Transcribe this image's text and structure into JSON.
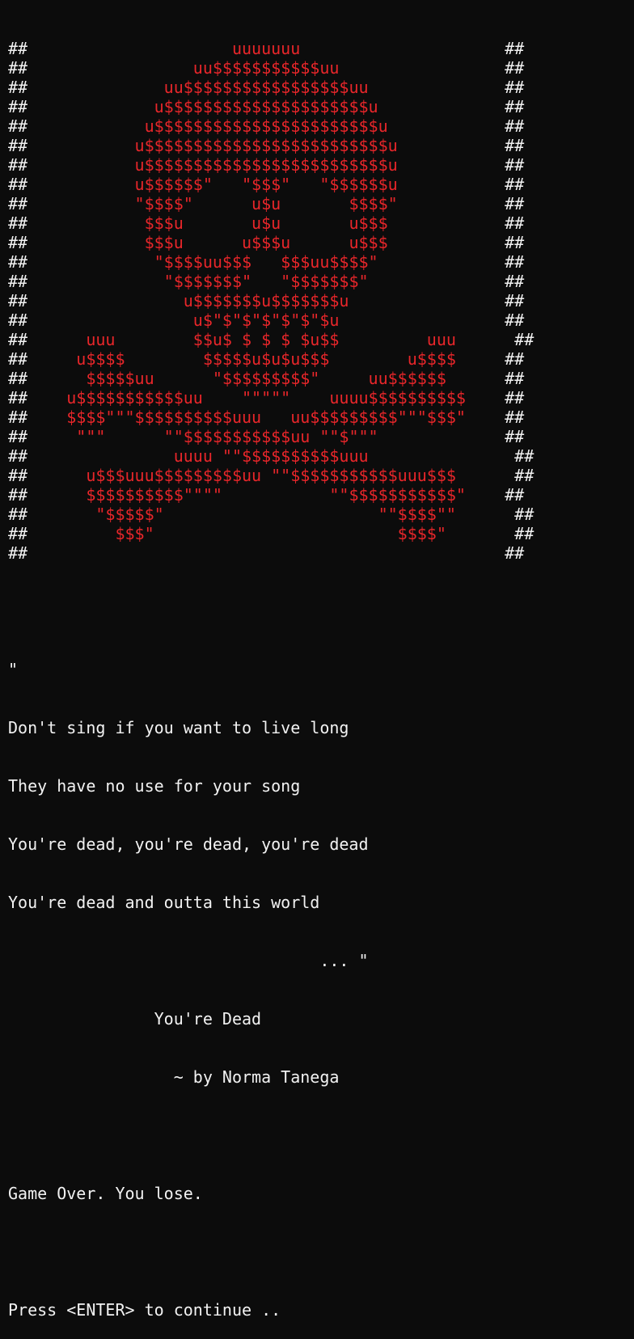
{
  "colors": {
    "background": "#0c0c0c",
    "text": "#f2f2f2",
    "skull": "#e8262a"
  },
  "skull_art": [
    {
      "border_left": "##",
      "art": "                     uuuuuuu                     ",
      "border_right": "##"
    },
    {
      "border_left": "##",
      "art": "                 uu$$$$$$$$$$$uu                 ",
      "border_right": "##"
    },
    {
      "border_left": "##",
      "art": "              uu$$$$$$$$$$$$$$$$$uu              ",
      "border_right": "##"
    },
    {
      "border_left": "##",
      "art": "             u$$$$$$$$$$$$$$$$$$$$$u             ",
      "border_right": "##"
    },
    {
      "border_left": "##",
      "art": "            u$$$$$$$$$$$$$$$$$$$$$$$u            ",
      "border_right": "##"
    },
    {
      "border_left": "##",
      "art": "           u$$$$$$$$$$$$$$$$$$$$$$$$$u           ",
      "border_right": "##"
    },
    {
      "border_left": "##",
      "art": "           u$$$$$$$$$$$$$$$$$$$$$$$$$u           ",
      "border_right": "##"
    },
    {
      "border_left": "##",
      "art": "           u$$$$$$\"   \"$$$\"   \"$$$$$$u           ",
      "border_right": "##"
    },
    {
      "border_left": "##",
      "art": "           \"$$$$\"      u$u       $$$$\"           ",
      "border_right": "##"
    },
    {
      "border_left": "##",
      "art": "            $$$u       u$u       u$$$            ",
      "border_right": "##"
    },
    {
      "border_left": "##",
      "art": "            $$$u      u$$$u      u$$$            ",
      "border_right": "##"
    },
    {
      "border_left": "##",
      "art": "             \"$$$$uu$$$   $$$uu$$$$\"             ",
      "border_right": "##"
    },
    {
      "border_left": "##",
      "art": "              \"$$$$$$$\"   \"$$$$$$$\"              ",
      "border_right": "##"
    },
    {
      "border_left": "##",
      "art": "                u$$$$$$$u$$$$$$$u                ",
      "border_right": "##"
    },
    {
      "border_left": "##",
      "art": "                 u$\"$\"$\"$\"$\"$\"$u                 ",
      "border_right": "##"
    },
    {
      "border_left": "##",
      "art": "      uuu        $$u$ $ $ $ $u$$         uuu      ",
      "border_right": "##"
    },
    {
      "border_left": "##",
      "art": "     u$$$$        $$$$$u$u$u$$$        u$$$$     ",
      "border_right": "##"
    },
    {
      "border_left": "##",
      "art": "      $$$$$uu      \"$$$$$$$$$\"     uu$$$$$$      ",
      "border_right": "##"
    },
    {
      "border_left": "##",
      "art": "    u$$$$$$$$$$$uu    \"\"\"\"\"    uuuu$$$$$$$$$$    ",
      "border_right": "##"
    },
    {
      "border_left": "##",
      "art": "    $$$$\"\"\"$$$$$$$$$$uuu   uu$$$$$$$$$\"\"\"$$$\"    ",
      "border_right": "##"
    },
    {
      "border_left": "##",
      "art": "     \"\"\"      \"\"$$$$$$$$$$$uu \"\"$\"\"\"             ",
      "border_right": "##"
    },
    {
      "border_left": "##",
      "art": "               uuuu \"\"$$$$$$$$$$uuu               ",
      "border_right": "##"
    },
    {
      "border_left": "##",
      "art": "      u$$$uuu$$$$$$$$$uu \"\"$$$$$$$$$$$uuu$$$      ",
      "border_right": "##"
    },
    {
      "border_left": "##",
      "art": "      $$$$$$$$$$\"\"\"\"           \"\"$$$$$$$$$$$\"    ",
      "border_right": "##"
    },
    {
      "border_left": "##",
      "art": "       \"$$$$$\"                      \"\"$$$$\"\"      ",
      "border_right": "##"
    },
    {
      "border_left": "##",
      "art": "         $$$\"                         $$$$\"       ",
      "border_right": "##"
    },
    {
      "border_left": "##",
      "art": "                                                 ",
      "border_right": "##"
    }
  ],
  "quote": {
    "open_mark": "\"",
    "lines": [
      "Don't sing if you want to live long",
      "They have no use for your song",
      "You're dead, you're dead, you're dead",
      "You're dead and outta this world"
    ],
    "close": "                                ... \"",
    "title": "               You're Dead",
    "author": "                 ~ by Norma Tanega"
  },
  "result_message": "Game Over. You lose.",
  "continue_prompt": "Press <ENTER> to continue .."
}
